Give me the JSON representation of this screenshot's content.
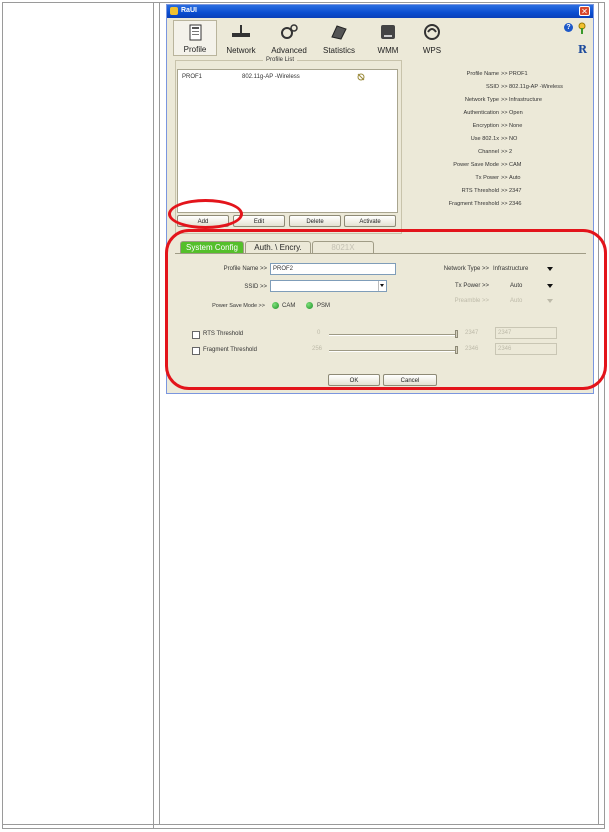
{
  "window": {
    "title": "RaUI",
    "close_glyph": "✕"
  },
  "toolbar": [
    {
      "label": "Profile",
      "icon": "profile-icon"
    },
    {
      "label": "Network",
      "icon": "network-icon"
    },
    {
      "label": "Advanced",
      "icon": "advanced-icon"
    },
    {
      "label": "Statistics",
      "icon": "statistics-icon"
    },
    {
      "label": "WMM",
      "icon": "wmm-icon"
    },
    {
      "label": "WPS",
      "icon": "wps-icon"
    }
  ],
  "toolbar_right": {
    "help": "?",
    "brand": "R"
  },
  "profile_list": {
    "legend": "Profile List",
    "rows": [
      {
        "name": "PROF1",
        "ssid": "802.11g-AP -Wireless"
      }
    ],
    "buttons": {
      "add": "Add",
      "edit": "Edit",
      "delete": "Delete",
      "activate": "Activate"
    }
  },
  "profile_info": [
    {
      "key": "Profile Name",
      "sep": ">>",
      "value": "PROF1"
    },
    {
      "key": "SSID",
      "sep": ">>",
      "value": "802.11g-AP -Wireless"
    },
    {
      "key": "Network Type",
      "sep": ">>",
      "value": "Infrastructure"
    },
    {
      "key": "Authentication",
      "sep": ">>",
      "value": "Open"
    },
    {
      "key": "Encryption",
      "sep": ">>",
      "value": "None"
    },
    {
      "key": "Use 802.1x",
      "sep": ">>",
      "value": "NO"
    },
    {
      "key": "Channel",
      "sep": ">>",
      "value": "2"
    },
    {
      "key": "Power Save Mode",
      "sep": ">>",
      "value": "CAM"
    },
    {
      "key": "Tx Power",
      "sep": ">>",
      "value": "Auto"
    },
    {
      "key": "RTS Threshold",
      "sep": ">>",
      "value": "2347"
    },
    {
      "key": "Fragment Threshold",
      "sep": ">>",
      "value": "2346"
    }
  ],
  "tabs": {
    "system_config": "System Config",
    "auth": "Auth. \\ Encry.",
    "dot1x": "8021X"
  },
  "form": {
    "profile_name_label": "Profile Name >>",
    "profile_name_value": "PROF2",
    "ssid_label": "SSID >>",
    "ssid_value": "",
    "power_save_label": "Power Save Mode >>",
    "cam_label": "CAM",
    "psm_label": "PSM",
    "network_type_label": "Network Type >>",
    "network_type_value": "Infrastructure",
    "tx_power_label": "Tx Power >>",
    "tx_power_value": "Auto",
    "preamble_label": "Preamble >>",
    "preamble_value": "Auto",
    "rts_label": "RTS Threshold",
    "rts_min": "0",
    "rts_max": "2347",
    "rts_value": "2347",
    "frag_label": "Fragment Threshold",
    "frag_min": "256",
    "frag_max": "2346",
    "frag_value": "2346",
    "ok": "OK",
    "cancel": "Cancel"
  }
}
